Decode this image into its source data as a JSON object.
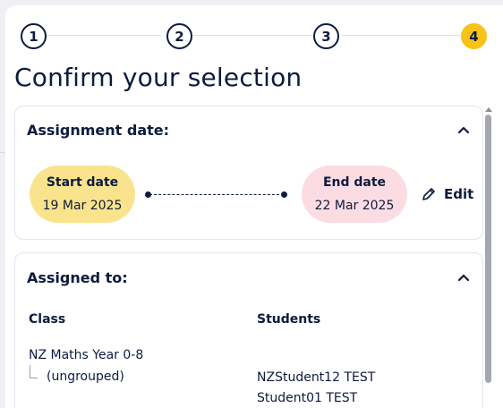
{
  "stepper": {
    "steps": [
      "1",
      "2",
      "3",
      "4"
    ],
    "active_step": "4"
  },
  "page_title": "Confirm your selection",
  "assignment_date": {
    "header": "Assignment date:",
    "start_label": "Start date",
    "start_value": "19 Mar 2025",
    "end_label": "End date",
    "end_value": "22 Mar 2025",
    "edit_label": "Edit",
    "edit_icon": "pencil-icon",
    "collapse_icon": "chevron-up-icon"
  },
  "assigned_to": {
    "header": "Assigned to:",
    "collapse_icon": "chevron-up-icon",
    "columns": [
      "Class",
      "Students"
    ],
    "class_name": "NZ Maths Year 0-8",
    "group_name": "(ungrouped)",
    "students": [
      "NZStudent12 TEST",
      "Student01 TEST"
    ]
  },
  "colors": {
    "navy": "#0d1b3d",
    "active_step": "#f7c316",
    "start_pill": "#f9e38c",
    "end_pill": "#fbdce2"
  }
}
